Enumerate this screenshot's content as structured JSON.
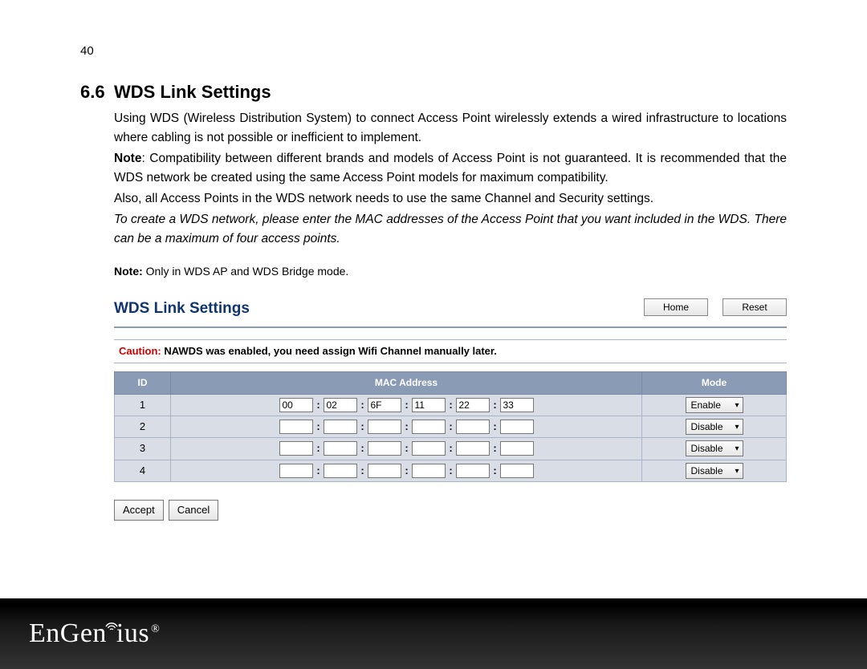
{
  "page_number": "40",
  "section": {
    "number": "6.6",
    "title": "WDS Link Settings"
  },
  "paragraphs": {
    "p1": "Using WDS (Wireless Distribution System) to connect Access Point wirelessly extends a wired infrastructure to locations where cabling is not possible or inefficient to implement.",
    "note_bold": "Note",
    "p2": ": Compatibility between different brands and models of Access Point is not guaranteed. It is recommended that the WDS network be created using the same Access Point models for maximum compatibility.",
    "p3": "Also, all Access Points in the WDS network needs to use the same Channel and Security settings.",
    "p4": "To create a WDS network, please enter the MAC addresses of the Access Point that you want included in the WDS. There can be a maximum of four access points."
  },
  "mode_note": {
    "bold": "Note:",
    "text": " Only in WDS AP and WDS Bridge mode."
  },
  "panel": {
    "title": "WDS Link Settings",
    "home": "Home",
    "reset": "Reset",
    "caution_label": "Caution:",
    "caution_text": "  NAWDS was enabled, you need assign Wifi Channel manually later.",
    "headers": {
      "id": "ID",
      "mac": "MAC Address",
      "mode": "Mode"
    },
    "rows": [
      {
        "id": "1",
        "mac": [
          "00",
          "02",
          "6F",
          "11",
          "22",
          "33"
        ],
        "mode": "Enable"
      },
      {
        "id": "2",
        "mac": [
          "",
          "",
          "",
          "",
          "",
          ""
        ],
        "mode": "Disable"
      },
      {
        "id": "3",
        "mac": [
          "",
          "",
          "",
          "",
          "",
          ""
        ],
        "mode": "Disable"
      },
      {
        "id": "4",
        "mac": [
          "",
          "",
          "",
          "",
          "",
          ""
        ],
        "mode": "Disable"
      }
    ],
    "accept": "Accept",
    "cancel": "Cancel"
  },
  "brand": "EnGenius"
}
